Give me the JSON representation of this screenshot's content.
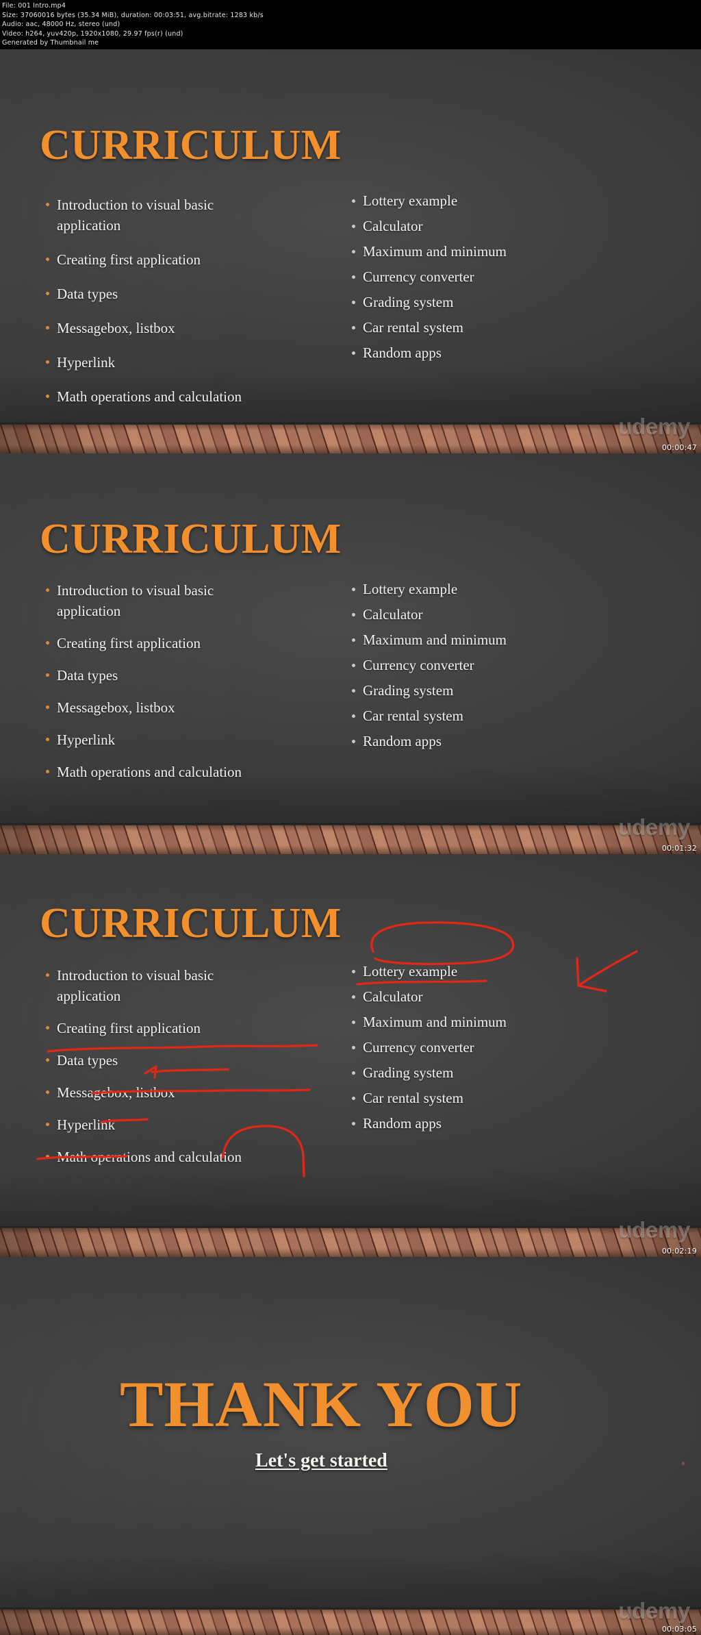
{
  "meta": {
    "lines": [
      "File: 001 Intro.mp4",
      "Size: 37060016 bytes (35.34 MiB), duration: 00:03:51, avg.bitrate: 1283 kb/s",
      "Audio: aac, 48000 Hz, stereo (und)",
      "Video: h264, yuv420p, 1920x1080, 29.97 fps(r) (und)",
      "Generated by Thumbnail me"
    ]
  },
  "colors": {
    "accent_orange": "#f2902e",
    "bullet_orange": "#e08a33",
    "bullet_grey": "#cfc9c2",
    "text_white": "#f4f2ef",
    "board_dark": "#3a3a3a",
    "annotation_red": "#e02718",
    "wood": "#a9705a"
  },
  "slides": [
    {
      "id": "slide-1",
      "title": "CURRICULUM",
      "watermark": "udemy",
      "timestamp": "00:00:47",
      "left_bullets": [
        "Introduction to visual basic application",
        "Creating first application",
        "Data types",
        "Messagebox, listbox",
        "Hyperlink",
        "Math operations and calculation"
      ],
      "right_bullets": [
        "Lottery example",
        "Calculator",
        "Maximum and minimum",
        "Currency converter",
        "Grading system",
        "Car rental system",
        "Random apps"
      ],
      "annotated": false
    },
    {
      "id": "slide-2",
      "title": "CURRICULUM",
      "watermark": "udemy",
      "timestamp": "00:01:32",
      "left_bullets": [
        "Introduction to visual basic application",
        "Creating first application",
        "Data types",
        "Messagebox, listbox",
        "Hyperlink",
        "Math operations and calculation"
      ],
      "right_bullets": [
        "Lottery example",
        "Calculator",
        "Maximum and minimum",
        "Currency converter",
        "Grading system",
        "Car rental system",
        "Random apps"
      ],
      "annotated": false
    },
    {
      "id": "slide-3",
      "title": "CURRICULUM",
      "watermark": "udemy",
      "timestamp": "00:02:19",
      "left_bullets": [
        "Introduction to visual basic application",
        "Creating first application",
        "Data types",
        "Messagebox, listbox",
        "Hyperlink",
        "Math operations and calculation"
      ],
      "right_bullets": [
        "Lottery example",
        "Calculator",
        "Maximum and minimum",
        "Currency converter",
        "Grading system",
        "Car rental system",
        "Random apps"
      ],
      "annotated": true,
      "annotations": [
        {
          "kind": "underline",
          "target": "Creating first application"
        },
        {
          "kind": "arrow",
          "target": "Data types"
        },
        {
          "kind": "underline",
          "target": "Messagebox, listbox"
        },
        {
          "kind": "underline",
          "target": "Hyperlink"
        },
        {
          "kind": "bracket",
          "target": "Math operations and calculation"
        },
        {
          "kind": "circle",
          "target": "Lottery example"
        },
        {
          "kind": "arrow",
          "target": "Lottery example"
        }
      ]
    },
    {
      "id": "slide-4",
      "title": "THANK YOU",
      "subtitle": "Let's get started",
      "watermark": "udemy",
      "timestamp": "00:03:05",
      "annotated": false
    }
  ]
}
